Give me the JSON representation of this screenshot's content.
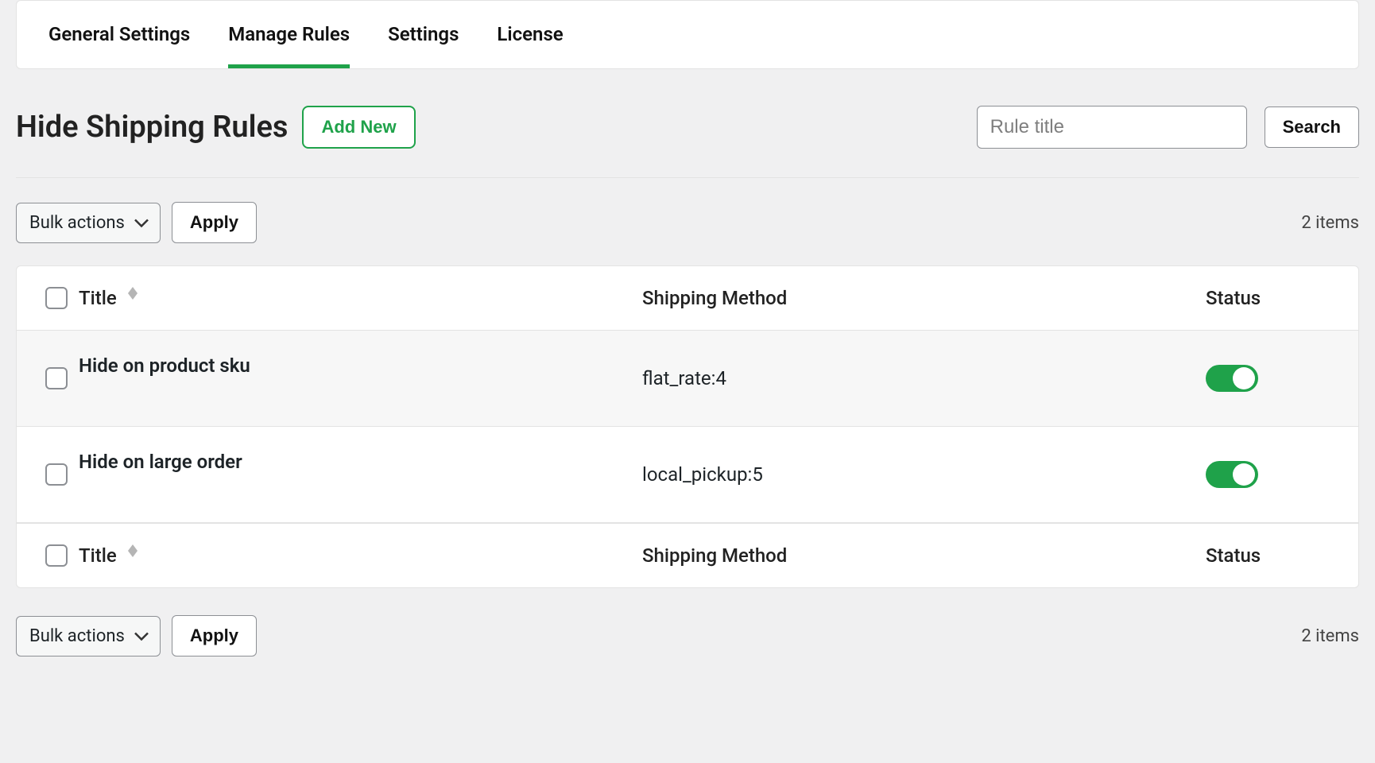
{
  "tabs": [
    {
      "label": "General Settings"
    },
    {
      "label": "Manage Rules",
      "active": true
    },
    {
      "label": "Settings"
    },
    {
      "label": "License"
    }
  ],
  "header": {
    "title": "Hide Shipping Rules",
    "add_new_label": "Add New"
  },
  "search": {
    "placeholder": "Rule title",
    "button_label": "Search"
  },
  "bulk": {
    "select_label": "Bulk actions",
    "apply_label": "Apply"
  },
  "items_count_label": "2 items",
  "columns": {
    "title": "Title",
    "method": "Shipping Method",
    "status": "Status"
  },
  "rows": [
    {
      "title": "Hide on product sku",
      "method": "flat_rate:4",
      "status_on": true
    },
    {
      "title": "Hide on large order",
      "method": "local_pickup:5",
      "status_on": true
    }
  ]
}
